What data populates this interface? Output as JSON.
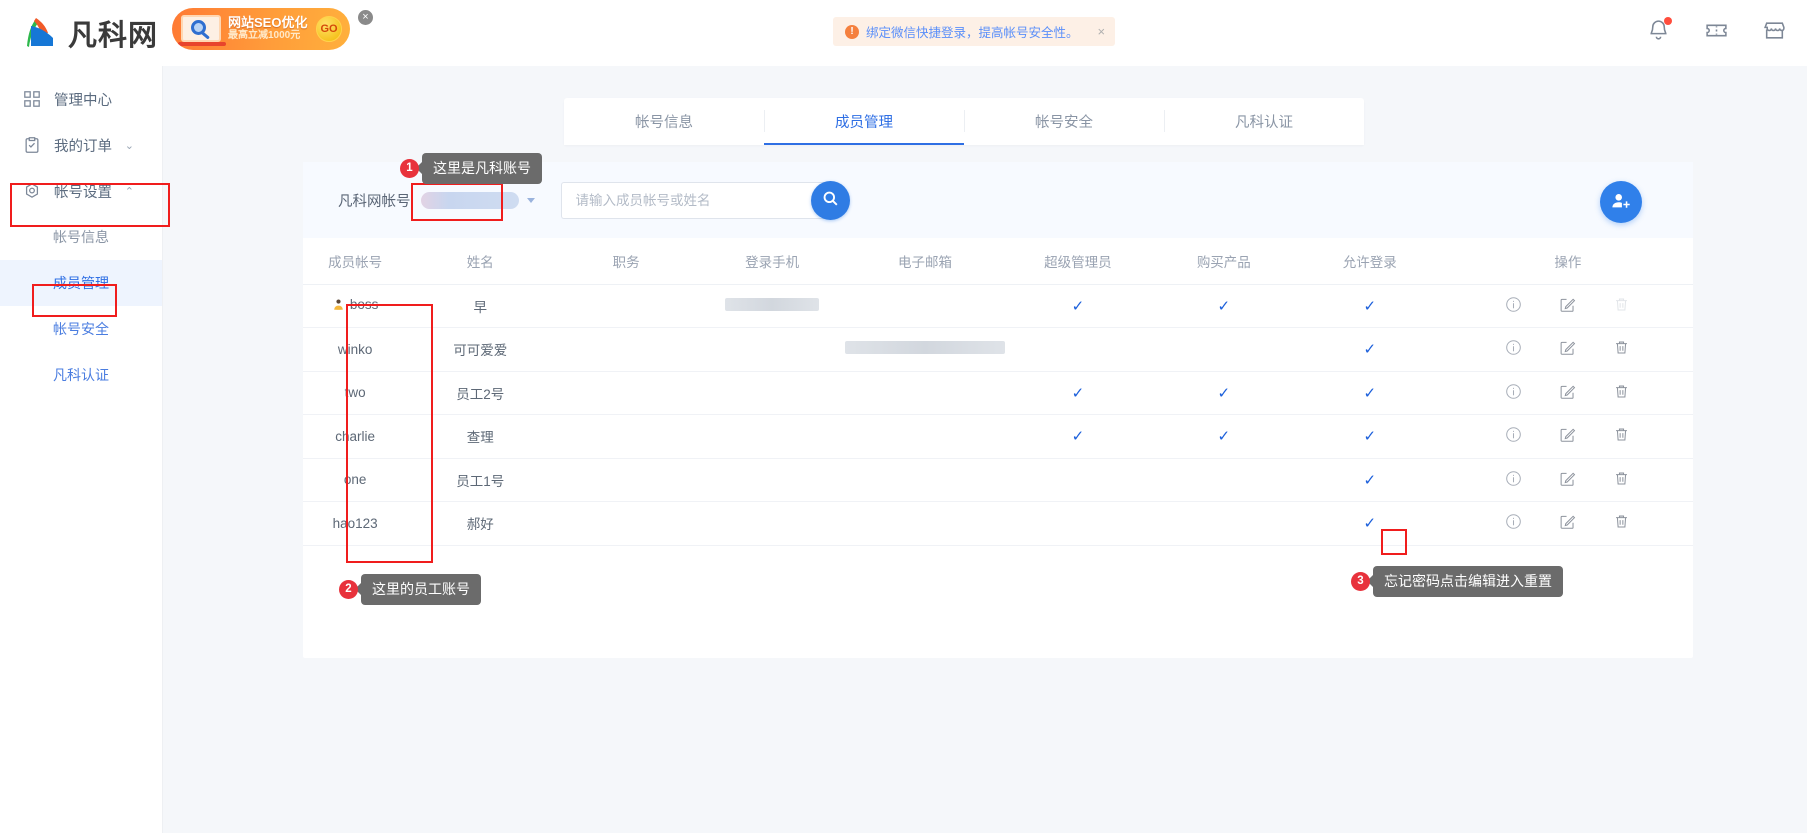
{
  "brand": {
    "name": "凡科网"
  },
  "ad": {
    "title": "网站SEO优化",
    "subtitle": "最高立减1000元",
    "cta": "GO",
    "close": "×"
  },
  "notice": {
    "icon": "!",
    "text": "绑定微信快捷登录，提高帐号安全性。",
    "close": "×"
  },
  "top_icons": [
    {
      "name": "bell-icon"
    },
    {
      "name": "ticket-icon"
    },
    {
      "name": "store-icon"
    }
  ],
  "sidebar": {
    "items": [
      {
        "label": "管理中心",
        "icon": "grid-icon",
        "chevron": ""
      },
      {
        "label": "我的订单",
        "icon": "clipboard-check-icon",
        "chevron": "⌄"
      },
      {
        "label": "帐号设置",
        "icon": "gear-icon",
        "chevron": "⌃"
      }
    ],
    "sub_items": [
      {
        "label": "帐号信息",
        "state": "muted"
      },
      {
        "label": "成员管理",
        "state": "active"
      },
      {
        "label": "帐号安全",
        "state": "link"
      },
      {
        "label": "凡科认证",
        "state": "link"
      }
    ]
  },
  "tabs": [
    {
      "label": "帐号信息",
      "active": false
    },
    {
      "label": "成员管理",
      "active": true
    },
    {
      "label": "帐号安全",
      "active": false
    },
    {
      "label": "凡科认证",
      "active": false
    }
  ],
  "search": {
    "account_label": "凡科网帐号",
    "account_value": "",
    "placeholder": "请输入成员帐号或姓名",
    "value": "",
    "search_icon": "search-icon",
    "add_member_icon": "add-user-icon"
  },
  "table": {
    "columns": [
      "成员帐号",
      "姓名",
      "职务",
      "登录手机",
      "电子邮箱",
      "超级管理员",
      "购买产品",
      "允许登录",
      "操作"
    ],
    "rows": [
      {
        "account": "boss",
        "is_owner": true,
        "name": "早",
        "title": "",
        "phone": "masked",
        "email": "",
        "super_admin": true,
        "purchase": true,
        "login": true,
        "actions": [
          "info-icon",
          "edit-icon",
          "trash-icon"
        ],
        "trash_disabled": true
      },
      {
        "account": "winko",
        "is_owner": false,
        "name": "可可爱爱",
        "title": "",
        "phone": "",
        "email": "masked",
        "super_admin": false,
        "purchase": false,
        "login": true,
        "actions": [
          "info-icon",
          "edit-icon",
          "trash-icon"
        ],
        "trash_disabled": false
      },
      {
        "account": "two",
        "is_owner": false,
        "name": "员工2号",
        "title": "",
        "phone": "",
        "email": "",
        "super_admin": true,
        "purchase": true,
        "login": true,
        "actions": [
          "info-icon",
          "edit-icon",
          "trash-icon"
        ],
        "trash_disabled": false
      },
      {
        "account": "charlie",
        "is_owner": false,
        "name": "查理",
        "title": "",
        "phone": "",
        "email": "",
        "super_admin": true,
        "purchase": true,
        "login": true,
        "actions": [
          "info-icon",
          "edit-icon",
          "trash-icon"
        ],
        "trash_disabled": false
      },
      {
        "account": "one",
        "is_owner": false,
        "name": "员工1号",
        "title": "",
        "phone": "",
        "email": "",
        "super_admin": false,
        "purchase": false,
        "login": true,
        "actions": [
          "info-icon",
          "edit-icon",
          "trash-icon"
        ],
        "trash_disabled": false
      },
      {
        "account": "hao123",
        "is_owner": false,
        "name": "郝好",
        "title": "",
        "phone": "",
        "email": "",
        "super_admin": false,
        "purchase": false,
        "login": true,
        "actions": [
          "info-icon",
          "edit-icon",
          "trash-icon"
        ],
        "trash_disabled": false
      }
    ],
    "check_mark": "✓"
  },
  "callouts": [
    {
      "num": "1",
      "text": "这里是凡科账号"
    },
    {
      "num": "2",
      "text": "这里的员工账号"
    },
    {
      "num": "3",
      "text": "忘记密码点击编辑进入重置"
    }
  ],
  "colors": {
    "accent": "#2f6fe4",
    "highlight": "#f01d1d",
    "check": "#1b5fdb",
    "callout_bg": "#6b6b6b",
    "callout_num": "#e8323c"
  }
}
